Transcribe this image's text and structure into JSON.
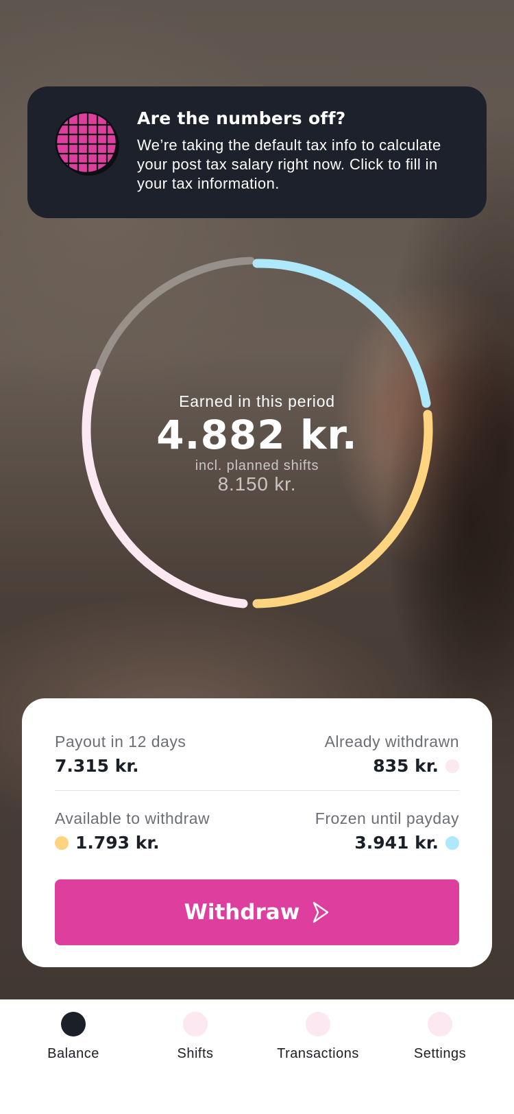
{
  "banner": {
    "title": "Are the numbers off?",
    "text": "We’re taking the default tax info to calculate your post tax salary right now. Click to fill in your tax information."
  },
  "summary": {
    "earned_label": "Earned in this period",
    "earned_value": "4.882 kr.",
    "planned_label": "incl. planned shifts",
    "planned_value": "8.150 kr."
  },
  "card": {
    "payout_label": "Payout in 12 days",
    "payout_value": "7.315 kr.",
    "withdrawn_label": "Already withdrawn",
    "withdrawn_value": "835 kr.",
    "available_label": "Available to withdraw",
    "available_value": "1.793 kr.",
    "frozen_label": "Frozen until payday",
    "frozen_value": "3.941 kr.",
    "withdraw_button": "Withdraw"
  },
  "nav": {
    "items": [
      {
        "label": "Balance",
        "active": true
      },
      {
        "label": "Shifts",
        "active": false
      },
      {
        "label": "Transactions",
        "active": false
      },
      {
        "label": "Settings",
        "active": false
      }
    ]
  },
  "colors": {
    "dark": "#1c212b",
    "accent": "#de3e9e",
    "available": "#ffd480",
    "frozen": "#aee9fb",
    "withdrawn": "#fbe8f1"
  }
}
